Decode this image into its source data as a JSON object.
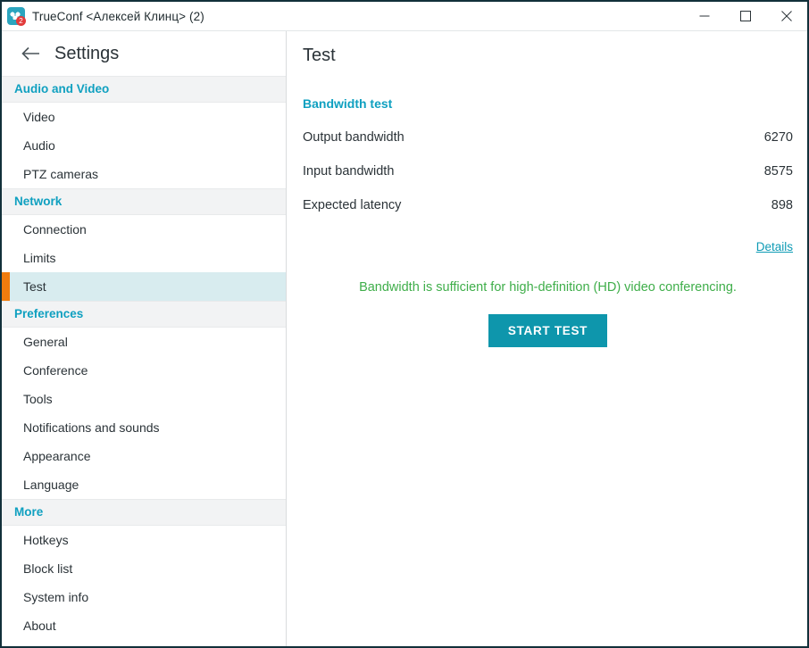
{
  "window": {
    "title": "TrueConf <Алексей Клинц> (2)",
    "icon": "trueconf-app-icon",
    "badge_count": "2",
    "controls": {
      "minimize": "minimize-icon",
      "maximize": "maximize-icon",
      "close": "close-icon"
    }
  },
  "sidebar": {
    "back_icon": "back-arrow-icon",
    "title": "Settings",
    "sections": [
      {
        "header": "Audio and Video",
        "items": [
          {
            "label": "Video",
            "selected": false
          },
          {
            "label": "Audio",
            "selected": false
          },
          {
            "label": "PTZ cameras",
            "selected": false
          }
        ]
      },
      {
        "header": "Network",
        "items": [
          {
            "label": "Connection",
            "selected": false
          },
          {
            "label": "Limits",
            "selected": false
          },
          {
            "label": "Test",
            "selected": true
          }
        ]
      },
      {
        "header": "Preferences",
        "items": [
          {
            "label": "General",
            "selected": false
          },
          {
            "label": "Conference",
            "selected": false
          },
          {
            "label": "Tools",
            "selected": false
          },
          {
            "label": "Notifications and sounds",
            "selected": false
          },
          {
            "label": "Appearance",
            "selected": false
          },
          {
            "label": "Language",
            "selected": false
          }
        ]
      },
      {
        "header": "More",
        "items": [
          {
            "label": "Hotkeys",
            "selected": false
          },
          {
            "label": "Block list",
            "selected": false
          },
          {
            "label": "System info",
            "selected": false
          },
          {
            "label": "About",
            "selected": false
          }
        ]
      }
    ]
  },
  "content": {
    "title": "Test",
    "section_label": "Bandwidth test",
    "metrics": [
      {
        "label": "Output bandwidth",
        "value": "6270"
      },
      {
        "label": "Input bandwidth",
        "value": "8575"
      },
      {
        "label": "Expected latency",
        "value": "898"
      }
    ],
    "details_link": "Details",
    "status_message": "Bandwidth is sufficient for high-definition (HD) video conferencing.",
    "start_test_label": "START TEST"
  },
  "colors": {
    "accent_teal": "#0fa0c0",
    "button_teal": "#0e96ac",
    "selected_row": "#d8ecef",
    "selected_marker": "#f07c0e",
    "status_green": "#3fae4a",
    "window_border": "#12303a",
    "section_band": "#f2f3f4"
  }
}
